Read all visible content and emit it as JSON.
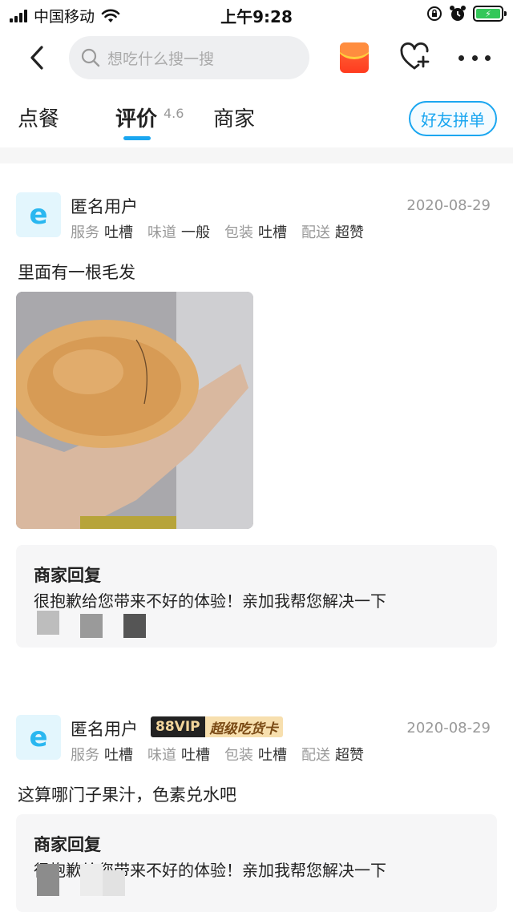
{
  "status_bar": {
    "carrier": "中国移动",
    "time": "上午9:28"
  },
  "header": {
    "search_placeholder": "想吃什么搜一搜",
    "icons": [
      "back-icon",
      "search-icon",
      "red-packet-icon",
      "heart-plus-icon",
      "more-icon"
    ]
  },
  "tabs": {
    "order": "点餐",
    "review": "评价",
    "review_score": "4.6",
    "merchant": "商家",
    "group_order": "好友拼单",
    "accent": "#1aa6f0"
  },
  "reviews": [
    {
      "user": "匿名用户",
      "date": "2020-08-29",
      "ratings": [
        {
          "label": "服务",
          "value": "吐槽"
        },
        {
          "label": "味道",
          "value": "一般"
        },
        {
          "label": "包装",
          "value": "吐槽"
        },
        {
          "label": "配送",
          "value": "超赞"
        }
      ],
      "text": "里面有一根毛发",
      "reply_title": "商家回复",
      "reply_text": "很抱歉给您带来不好的体验！亲加我帮您解决一下"
    },
    {
      "user": "匿名用户",
      "vip": "88VIP",
      "vip_card": "超级吃货卡",
      "date": "2020-08-29",
      "ratings": [
        {
          "label": "服务",
          "value": "吐槽"
        },
        {
          "label": "味道",
          "value": "吐槽"
        },
        {
          "label": "包装",
          "value": "吐槽"
        },
        {
          "label": "配送",
          "value": "超赞"
        }
      ],
      "text": "这算哪门子果汁，色素兑水吧",
      "reply_title": "商家回复",
      "reply_text": "很抱歉给您带来不好的体验！亲加我帮您解决一下"
    }
  ]
}
